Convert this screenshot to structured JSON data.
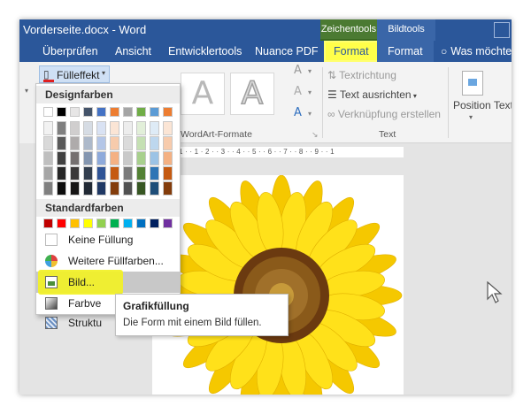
{
  "window": {
    "title": "Vorderseite.docx - Word",
    "context_headers": {
      "drawing_tools": "Zeichentools",
      "picture_tools": "Bildtools"
    },
    "accent_color": "#2b579a"
  },
  "tabs": [
    {
      "label": "Überprüfen"
    },
    {
      "label": "Ansicht"
    },
    {
      "label": "Entwicklertools"
    },
    {
      "label": "Nuance PDF"
    },
    {
      "label": "Format",
      "active": true
    },
    {
      "label": "Format"
    }
  ],
  "tell_me": "Was möchte",
  "ribbon": {
    "wordart_group_label": "WordArt-Formate",
    "text_group_label": "Text",
    "text_direction": "Textrichtung",
    "align_text": "Text ausrichten",
    "create_link": "Verknüpfung erstellen",
    "position": "Position",
    "wrap_text_partial": "Text"
  },
  "ruler_text": "1 · · 1 · 2 · · 3 · · 4 · · 5 · · 6 · · 7 · · 8 · · 9 · · 1",
  "fill_menu": {
    "button_label": "Fülleffekt",
    "design_colors_heading": "Designfarben",
    "standard_colors_heading": "Standardfarben",
    "no_fill": "Keine Füllung",
    "more_fill_colors": "Weitere Füllfarben...",
    "picture": "Bild...",
    "gradient_partial": "Farbve",
    "texture_partial": "Struktu"
  },
  "tooltip": {
    "title": "Grafikfüllung",
    "description": "Die Form mit einem Bild füllen."
  },
  "design_color_columns": [
    [
      "#ffffff",
      "#f2f2f2",
      "#d9d9d9",
      "#bfbfbf",
      "#a6a6a6",
      "#808080"
    ],
    [
      "#000000",
      "#7f7f7f",
      "#595959",
      "#404040",
      "#262626",
      "#0d0d0d"
    ],
    [
      "#e7e6e6",
      "#d0cece",
      "#aeabab",
      "#757070",
      "#3a3838",
      "#171616"
    ],
    [
      "#44546a",
      "#d6dce4",
      "#adb9ca",
      "#8496b0",
      "#333f4f",
      "#222a35"
    ],
    [
      "#4472c4",
      "#d9e2f3",
      "#b4c6e7",
      "#8eaadb",
      "#2f5496",
      "#1f3864"
    ],
    [
      "#ed7d31",
      "#fbe5d5",
      "#f7cbac",
      "#f4b183",
      "#c55a11",
      "#833c0b"
    ],
    [
      "#a5a5a5",
      "#ededed",
      "#dbdbdb",
      "#c9c9c9",
      "#7b7b7b",
      "#525252"
    ],
    [
      "#70ad47",
      "#e2efd9",
      "#c5e0b3",
      "#a8d08d",
      "#538135",
      "#375623"
    ],
    [
      "#5b9bd5",
      "#deebf6",
      "#bdd7ee",
      "#9cc3e5",
      "#2e75b5",
      "#1e4e79"
    ],
    [
      "#ed7d31",
      "#fbe5d5",
      "#f7cbac",
      "#f4b183",
      "#c55a11",
      "#833c0b"
    ]
  ],
  "standard_colors": [
    "#c00000",
    "#ff0000",
    "#ffc000",
    "#ffff00",
    "#92d050",
    "#00b050",
    "#00b0f0",
    "#0070c0",
    "#002060",
    "#7030a0"
  ]
}
